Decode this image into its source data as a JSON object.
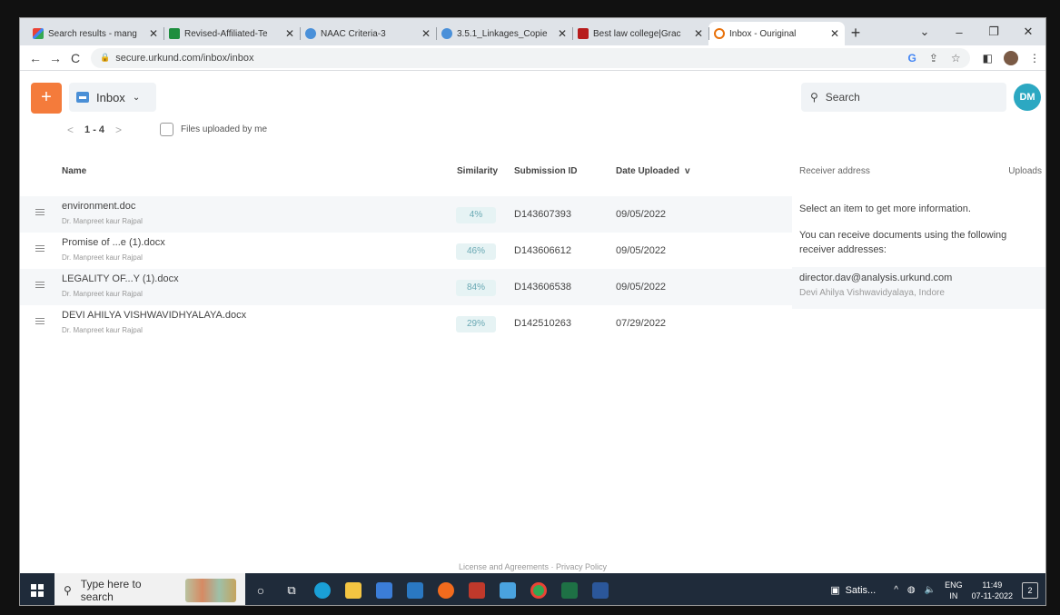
{
  "browser": {
    "tabs": [
      {
        "title": "Search results - mang",
        "favicon": "gmail-icon",
        "active": false
      },
      {
        "title": "Revised-Affiliated-Te",
        "favicon": "sheets-icon",
        "active": false
      },
      {
        "title": "NAAC Criteria-3",
        "favicon": "web-icon",
        "active": false
      },
      {
        "title": "3.5.1_Linkages_Copie",
        "favicon": "web-icon",
        "active": false
      },
      {
        "title": "Best law college|Grac",
        "favicon": "law-icon",
        "active": false
      },
      {
        "title": "Inbox - Ouriginal",
        "favicon": "ouriginal-icon",
        "active": true
      }
    ],
    "new_tab": "+",
    "url": "secure.urkund.com/inbox/inbox"
  },
  "app": {
    "new_button": "+",
    "folder_label": "Inbox",
    "search_placeholder": "Search",
    "avatar_initials": "DM",
    "pager": {
      "prev": "<",
      "range": "1 - 4",
      "next": ">"
    },
    "filter_label": "Files uploaded by me",
    "columns": {
      "name": "Name",
      "similarity": "Similarity",
      "submission_id": "Submission ID",
      "date_uploaded": "Date Uploaded",
      "sort_indicator": "v"
    },
    "rows": [
      {
        "name": "environment.doc",
        "author": "Dr. Manpreet kaur Rajpal",
        "similarity": "4%",
        "submission_id": "D143607393",
        "date": "09/05/2022"
      },
      {
        "name": "Promise of ...e (1).docx",
        "author": "Dr. Manpreet kaur Rajpal",
        "similarity": "46%",
        "submission_id": "D143606612",
        "date": "09/05/2022"
      },
      {
        "name": "LEGALITY OF...Y (1).docx",
        "author": "Dr. Manpreet kaur Rajpal",
        "similarity": "84%",
        "submission_id": "D143606538",
        "date": "09/05/2022"
      },
      {
        "name": "DEVI AHILYA VISHWAVIDHYALAYA.docx",
        "author": "Dr. Manpreet kaur Rajpal",
        "similarity": "29%",
        "submission_id": "D142510263",
        "date": "07/29/2022"
      }
    ],
    "side_panel": {
      "receiver_header": "Receiver address",
      "uploads_header": "Uploads",
      "select_hint": "Select an item to get more information.",
      "receive_info": "You can receive documents using the following receiver addresses:",
      "address": "director.dav@analysis.urkund.com",
      "organization": "Devi Ahilya Vishwavidyalaya, Indore"
    },
    "footer": "License and Agreements · Privacy Policy"
  },
  "taskbar": {
    "search_placeholder": "Type here to search",
    "pinned": [
      "cortana-icon",
      "task-view-icon",
      "edge-icon",
      "file-explorer-icon",
      "store-icon",
      "mail-icon",
      "firefox-icon",
      "app-icon",
      "photos-icon",
      "chrome-icon",
      "excel-icon",
      "word-icon"
    ],
    "running_window": "Satis...",
    "language": "ENG",
    "region": "IN",
    "time": "11:49",
    "date": "07-11-2022",
    "notifications": "2"
  }
}
